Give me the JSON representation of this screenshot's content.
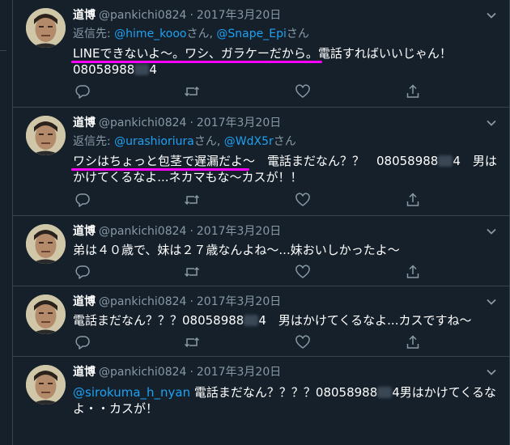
{
  "colors": {
    "background": "#15202b",
    "divider": "#38444d",
    "secondary_text": "#8899a6",
    "link": "#1da1f2",
    "highlight_underline": "#ff00ff"
  },
  "icons": {
    "more": "chevron-down-icon",
    "reply": "reply-icon",
    "retweet": "retweet-icon",
    "like": "heart-icon",
    "share": "share-icon"
  },
  "tweets": [
    {
      "name": "道博",
      "handle": "@pankichi0824",
      "sep": "·",
      "date": "2017年3月20日",
      "reply_prefix": "返信先: ",
      "reply_user1": "@hime_kooo",
      "reply_mid": "さん, ",
      "reply_user2": "@Snape_Epi",
      "reply_suffix": "さん",
      "line1": "LINEできないよ～。ワシ、ガラケーだから。電話すればいいじゃん！",
      "line2_a": "08058988",
      "line2_b": "4"
    },
    {
      "name": "道博",
      "handle": "@pankichi0824",
      "sep": "·",
      "date": "2017年3月20日",
      "reply_prefix": "返信先: ",
      "reply_user1": "@urashioriura",
      "reply_mid": "さん, ",
      "reply_user2": "@WdX5r",
      "reply_suffix": "さん",
      "line1_a": "ワシはちょっと包茎で遅漏だよ～　電話まだなん？？　08058988",
      "line1_b": "4　男は",
      "line2": "かけてくるなよ...ネカマもな～カスが！！"
    },
    {
      "name": "道博",
      "handle": "@pankichi0824",
      "sep": "·",
      "date": "2017年3月20日",
      "line1": "弟は４０歳で、妹は２７歳なんよね～...妹おいしかったよ～"
    },
    {
      "name": "道博",
      "handle": "@pankichi0824",
      "sep": "·",
      "date": "2017年3月20日",
      "line1_a": "電話まだなん？？？08058988",
      "line1_b": "4　男はかけてくるなよ...カスですね～"
    },
    {
      "name": "道博",
      "handle": "@pankichi0824",
      "sep": "·",
      "date": "2017年3月20日",
      "mention": "@sirokuma_h_nyan",
      "line1_a": " 電話まだなん？？？？08058988",
      "line1_b": "4男はかけてくるな",
      "line2": "よ・・カスが！"
    }
  ]
}
